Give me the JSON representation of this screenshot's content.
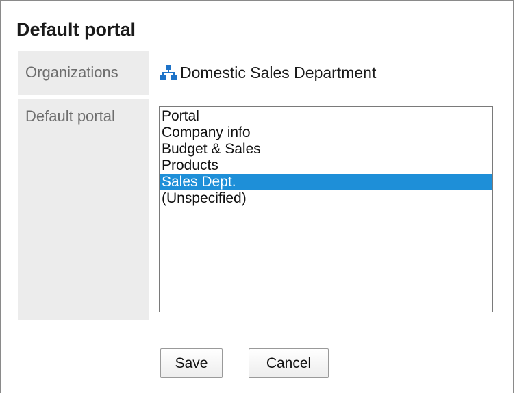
{
  "page": {
    "title": "Default portal"
  },
  "organizations": {
    "label": "Organizations",
    "icon": "organization-tree-icon",
    "icon_color": "#1e73c8",
    "value": "Domestic Sales Department"
  },
  "default_portal": {
    "label": "Default portal",
    "options": [
      {
        "label": "Portal",
        "selected": false
      },
      {
        "label": "Company info",
        "selected": false
      },
      {
        "label": "Budget & Sales",
        "selected": false
      },
      {
        "label": "Products",
        "selected": false
      },
      {
        "label": "Sales Dept.",
        "selected": true
      },
      {
        "label": "(Unspecified)",
        "selected": false
      }
    ],
    "selected_color": "#1e8fd8"
  },
  "actions": {
    "save_label": "Save",
    "cancel_label": "Cancel"
  }
}
